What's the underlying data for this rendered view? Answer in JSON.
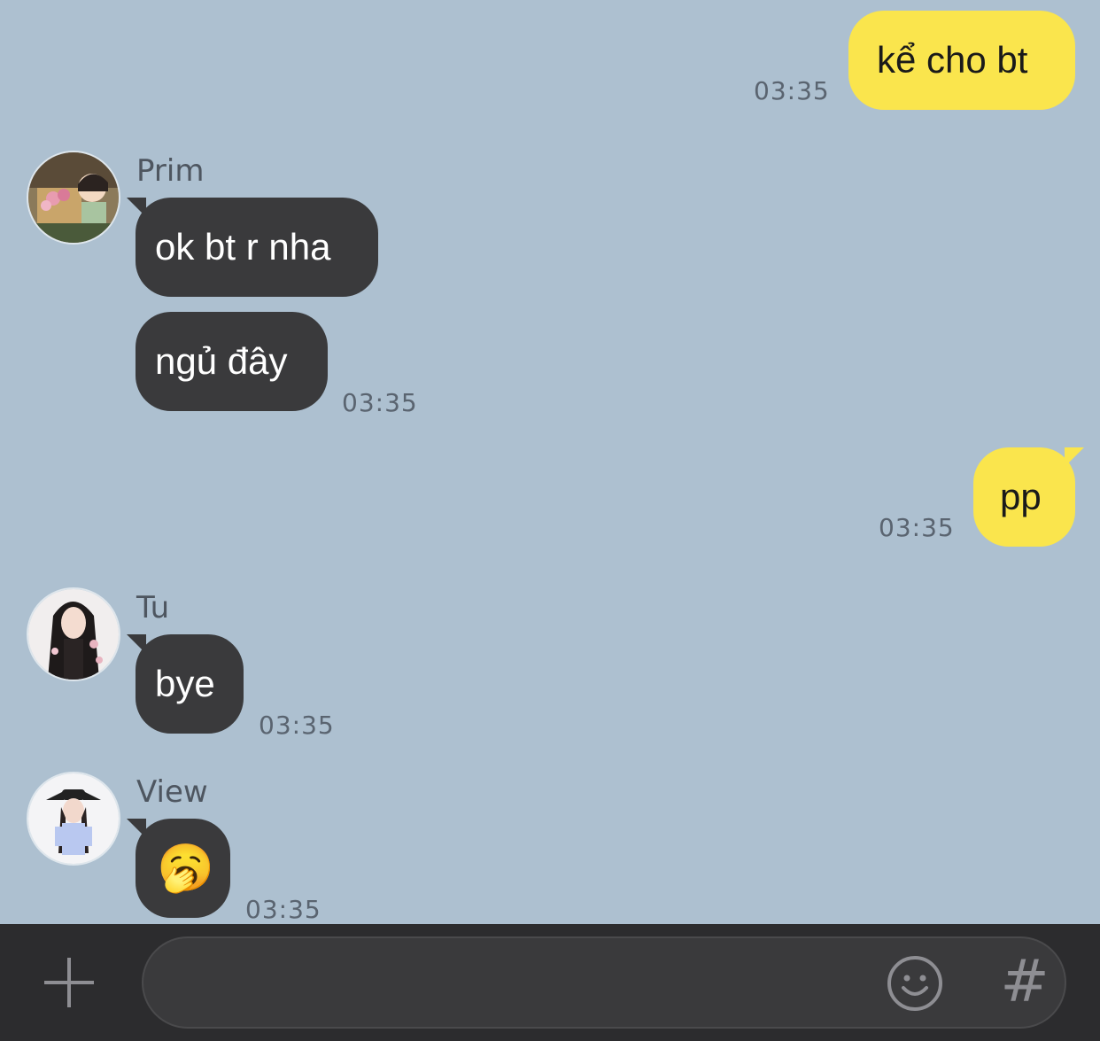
{
  "messages": [
    {
      "side": "mine",
      "text": "kể cho bt",
      "time": "03:35"
    },
    {
      "side": "theirs",
      "sender": "Prim",
      "text": "ok bt r nha"
    },
    {
      "side": "theirs",
      "text": "ngủ đây",
      "time": "03:35"
    },
    {
      "side": "mine",
      "text": "pp",
      "time": "03:35"
    },
    {
      "side": "theirs",
      "sender": "Tu",
      "text": "bye",
      "time": "03:35"
    },
    {
      "side": "theirs",
      "sender": "View",
      "text": "🥱",
      "time": "03:35"
    }
  ],
  "input": {
    "placeholder": "",
    "value": ""
  },
  "icons": {
    "attach": "plus-icon",
    "emoji": "smiley-face-icon",
    "hashtag": "hashtag-icon"
  },
  "colors": {
    "background": "#adc0d0",
    "mine_bubble": "#fae54d",
    "theirs_bubble": "#3a3a3c",
    "bottom_bar": "#2c2c2e"
  }
}
